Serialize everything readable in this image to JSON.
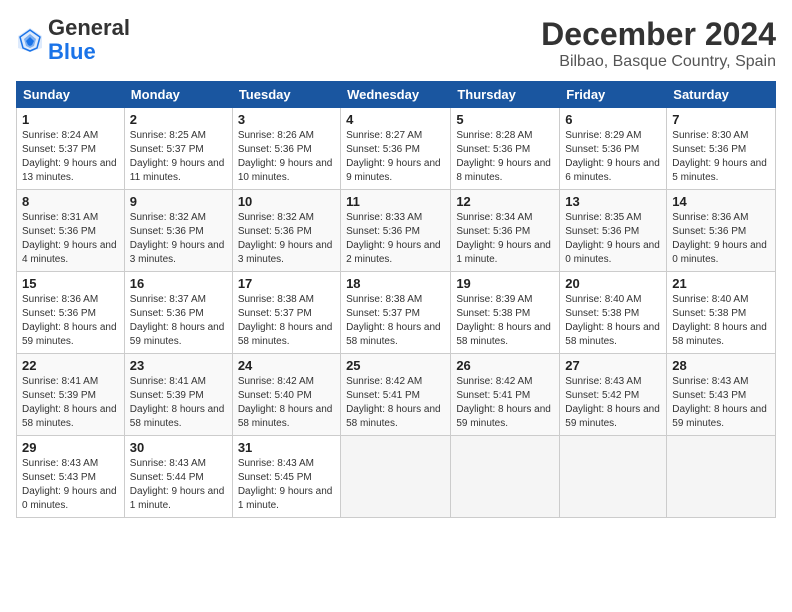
{
  "logo": {
    "general": "General",
    "blue": "Blue"
  },
  "title": "December 2024",
  "subtitle": "Bilbao, Basque Country, Spain",
  "weekdays": [
    "Sunday",
    "Monday",
    "Tuesday",
    "Wednesday",
    "Thursday",
    "Friday",
    "Saturday"
  ],
  "weeks": [
    [
      {
        "day": "1",
        "sunrise": "8:24 AM",
        "sunset": "5:37 PM",
        "daylight": "9 hours and 13 minutes."
      },
      {
        "day": "2",
        "sunrise": "8:25 AM",
        "sunset": "5:37 PM",
        "daylight": "9 hours and 11 minutes."
      },
      {
        "day": "3",
        "sunrise": "8:26 AM",
        "sunset": "5:36 PM",
        "daylight": "9 hours and 10 minutes."
      },
      {
        "day": "4",
        "sunrise": "8:27 AM",
        "sunset": "5:36 PM",
        "daylight": "9 hours and 9 minutes."
      },
      {
        "day": "5",
        "sunrise": "8:28 AM",
        "sunset": "5:36 PM",
        "daylight": "9 hours and 8 minutes."
      },
      {
        "day": "6",
        "sunrise": "8:29 AM",
        "sunset": "5:36 PM",
        "daylight": "9 hours and 6 minutes."
      },
      {
        "day": "7",
        "sunrise": "8:30 AM",
        "sunset": "5:36 PM",
        "daylight": "9 hours and 5 minutes."
      }
    ],
    [
      {
        "day": "8",
        "sunrise": "8:31 AM",
        "sunset": "5:36 PM",
        "daylight": "9 hours and 4 minutes."
      },
      {
        "day": "9",
        "sunrise": "8:32 AM",
        "sunset": "5:36 PM",
        "daylight": "9 hours and 3 minutes."
      },
      {
        "day": "10",
        "sunrise": "8:32 AM",
        "sunset": "5:36 PM",
        "daylight": "9 hours and 3 minutes."
      },
      {
        "day": "11",
        "sunrise": "8:33 AM",
        "sunset": "5:36 PM",
        "daylight": "9 hours and 2 minutes."
      },
      {
        "day": "12",
        "sunrise": "8:34 AM",
        "sunset": "5:36 PM",
        "daylight": "9 hours and 1 minute."
      },
      {
        "day": "13",
        "sunrise": "8:35 AM",
        "sunset": "5:36 PM",
        "daylight": "9 hours and 0 minutes."
      },
      {
        "day": "14",
        "sunrise": "8:36 AM",
        "sunset": "5:36 PM",
        "daylight": "9 hours and 0 minutes."
      }
    ],
    [
      {
        "day": "15",
        "sunrise": "8:36 AM",
        "sunset": "5:36 PM",
        "daylight": "8 hours and 59 minutes."
      },
      {
        "day": "16",
        "sunrise": "8:37 AM",
        "sunset": "5:36 PM",
        "daylight": "8 hours and 59 minutes."
      },
      {
        "day": "17",
        "sunrise": "8:38 AM",
        "sunset": "5:37 PM",
        "daylight": "8 hours and 58 minutes."
      },
      {
        "day": "18",
        "sunrise": "8:38 AM",
        "sunset": "5:37 PM",
        "daylight": "8 hours and 58 minutes."
      },
      {
        "day": "19",
        "sunrise": "8:39 AM",
        "sunset": "5:38 PM",
        "daylight": "8 hours and 58 minutes."
      },
      {
        "day": "20",
        "sunrise": "8:40 AM",
        "sunset": "5:38 PM",
        "daylight": "8 hours and 58 minutes."
      },
      {
        "day": "21",
        "sunrise": "8:40 AM",
        "sunset": "5:38 PM",
        "daylight": "8 hours and 58 minutes."
      }
    ],
    [
      {
        "day": "22",
        "sunrise": "8:41 AM",
        "sunset": "5:39 PM",
        "daylight": "8 hours and 58 minutes."
      },
      {
        "day": "23",
        "sunrise": "8:41 AM",
        "sunset": "5:39 PM",
        "daylight": "8 hours and 58 minutes."
      },
      {
        "day": "24",
        "sunrise": "8:42 AM",
        "sunset": "5:40 PM",
        "daylight": "8 hours and 58 minutes."
      },
      {
        "day": "25",
        "sunrise": "8:42 AM",
        "sunset": "5:41 PM",
        "daylight": "8 hours and 58 minutes."
      },
      {
        "day": "26",
        "sunrise": "8:42 AM",
        "sunset": "5:41 PM",
        "daylight": "8 hours and 59 minutes."
      },
      {
        "day": "27",
        "sunrise": "8:43 AM",
        "sunset": "5:42 PM",
        "daylight": "8 hours and 59 minutes."
      },
      {
        "day": "28",
        "sunrise": "8:43 AM",
        "sunset": "5:43 PM",
        "daylight": "8 hours and 59 minutes."
      }
    ],
    [
      {
        "day": "29",
        "sunrise": "8:43 AM",
        "sunset": "5:43 PM",
        "daylight": "9 hours and 0 minutes."
      },
      {
        "day": "30",
        "sunrise": "8:43 AM",
        "sunset": "5:44 PM",
        "daylight": "9 hours and 1 minute."
      },
      {
        "day": "31",
        "sunrise": "8:43 AM",
        "sunset": "5:45 PM",
        "daylight": "9 hours and 1 minute."
      },
      null,
      null,
      null,
      null
    ]
  ]
}
